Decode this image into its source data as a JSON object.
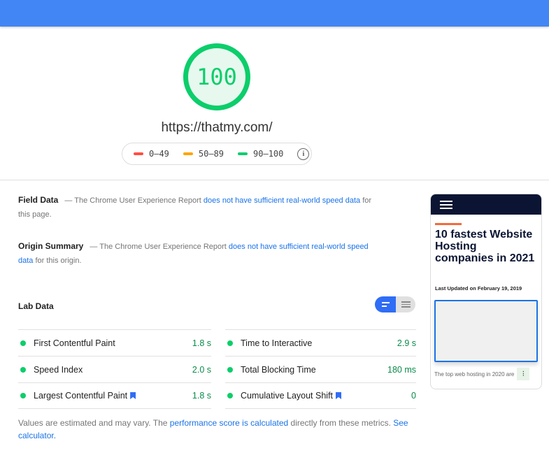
{
  "score": {
    "value": "100",
    "color": "#0cce6b"
  },
  "url": "https://thatmy.com/",
  "legend": [
    {
      "label": "0–49",
      "color": "#ff4e42"
    },
    {
      "label": "50–89",
      "color": "#ffa400"
    },
    {
      "label": "90–100",
      "color": "#0cce6b"
    }
  ],
  "legend_info_icon": "info-icon",
  "field_data": {
    "title": "Field Data",
    "pre": "— The Chrome User Experience Report ",
    "link": "does not have sufficient real-world speed data",
    "post": " for this page."
  },
  "origin_summary": {
    "title": "Origin Summary",
    "pre": "— The Chrome User Experience Report ",
    "link": "does not have sufficient real-world speed data",
    "post": " for this origin."
  },
  "lab": {
    "title": "Lab Data",
    "metrics_left": [
      {
        "label": "First Contentful Paint",
        "value": "1.8 s"
      },
      {
        "label": "Speed Index",
        "value": "2.0 s"
      },
      {
        "label": "Largest Contentful Paint",
        "value": "1.8 s"
      }
    ],
    "metrics_right": [
      {
        "label": "Time to Interactive",
        "value": "2.9 s"
      },
      {
        "label": "Total Blocking Time",
        "value": "180 ms"
      },
      {
        "label": "Cumulative Layout Shift",
        "value": "0"
      }
    ]
  },
  "footer": {
    "pre": "Values are estimated and may vary. The ",
    "link1": "performance score is calculated",
    "mid": " directly from these metrics. ",
    "link2": "See calculator."
  },
  "thumbnail": {
    "headline": "10 fastest Website Hosting companies in 2021",
    "updated": "Last Updated on February 19, 2019",
    "snippet": "The top web hosting in 2020 are"
  },
  "colors": {
    "header": "#4285f4",
    "pass": "#0cce6b",
    "link": "#1a73e8"
  }
}
